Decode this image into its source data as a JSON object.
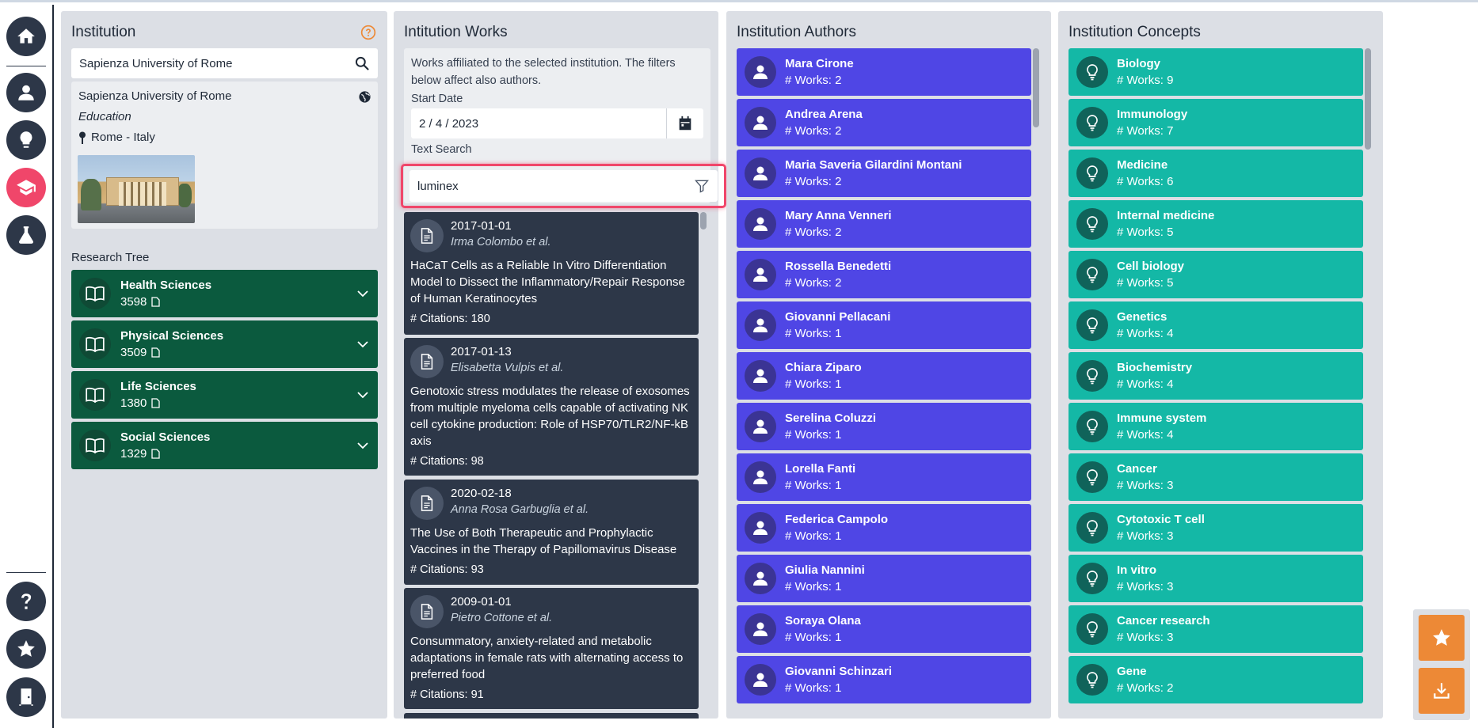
{
  "institution": {
    "panel_title": "Institution",
    "search_value": "Sapienza University of Rome",
    "name": "Sapienza University of Rome",
    "type": "Education",
    "location": "Rome - Italy",
    "research_tree_label": "Research Tree",
    "tree": [
      {
        "label": "Health Sciences",
        "count": "3598"
      },
      {
        "label": "Physical Sciences",
        "count": "3509"
      },
      {
        "label": "Life Sciences",
        "count": "1380"
      },
      {
        "label": "Social Sciences",
        "count": "1329"
      }
    ]
  },
  "works": {
    "panel_title": "Intitution Works",
    "description": "Works affiliated to the selected institution. The filters below affect also authors.",
    "start_date_label": "Start Date",
    "start_date_value": "2 / 4 / 2023",
    "text_search_label": "Text Search",
    "text_search_value": "luminex",
    "items": [
      {
        "date": "2017-01-01",
        "authors": "Irma Colombo et al.",
        "title": "HaCaT Cells as a Reliable In Vitro Differentiation Model to Dissect the Inflammatory/Repair Response of Human Keratinocytes",
        "citations": "# Citations: 180"
      },
      {
        "date": "2017-01-13",
        "authors": "Elisabetta Vulpis et al.",
        "title": "Genotoxic stress modulates the release of exosomes from multiple myeloma cells capable of activating NK cell cytokine production: Role of HSP70/TLR2/NF-kB axis",
        "citations": "# Citations: 98"
      },
      {
        "date": "2020-02-18",
        "authors": "Anna Rosa Garbuglia et al.",
        "title": "The Use of Both Therapeutic and Prophylactic Vaccines in the Therapy of Papillomavirus Disease",
        "citations": "# Citations: 93"
      },
      {
        "date": "2009-01-01",
        "authors": "Pietro Cottone et al.",
        "title": "Consummatory, anxiety-related and metabolic adaptations in female rats with alternating access to preferred food",
        "citations": "# Citations: 91"
      }
    ]
  },
  "authors": {
    "panel_title": "Institution Authors",
    "items": [
      {
        "name": "Mara Cirone",
        "works": "# Works: 2"
      },
      {
        "name": "Andrea Arena",
        "works": "# Works: 2"
      },
      {
        "name": "Maria Saveria Gilardini Montani",
        "works": "# Works: 2"
      },
      {
        "name": "Mary Anna Venneri",
        "works": "# Works: 2"
      },
      {
        "name": "Rossella Benedetti",
        "works": "# Works: 2"
      },
      {
        "name": "Giovanni Pellacani",
        "works": "# Works: 1"
      },
      {
        "name": "Chiara Ziparo",
        "works": "# Works: 1"
      },
      {
        "name": "Serelina Coluzzi",
        "works": "# Works: 1"
      },
      {
        "name": "Lorella Fanti",
        "works": "# Works: 1"
      },
      {
        "name": "Federica Campolo",
        "works": "# Works: 1"
      },
      {
        "name": "Giulia Nannini",
        "works": "# Works: 1"
      },
      {
        "name": "Soraya Olana",
        "works": "# Works: 1"
      },
      {
        "name": "Giovanni Schinzari",
        "works": "# Works: 1"
      }
    ]
  },
  "concepts": {
    "panel_title": "Institution Concepts",
    "items": [
      {
        "name": "Biology",
        "works": "# Works: 9"
      },
      {
        "name": "Immunology",
        "works": "# Works: 7"
      },
      {
        "name": "Medicine",
        "works": "# Works: 6"
      },
      {
        "name": "Internal medicine",
        "works": "# Works: 5"
      },
      {
        "name": "Cell biology",
        "works": "# Works: 5"
      },
      {
        "name": "Genetics",
        "works": "# Works: 4"
      },
      {
        "name": "Biochemistry",
        "works": "# Works: 4"
      },
      {
        "name": "Immune system",
        "works": "# Works: 4"
      },
      {
        "name": "Cancer",
        "works": "# Works: 3"
      },
      {
        "name": "Cytotoxic T cell",
        "works": "# Works: 3"
      },
      {
        "name": "In vitro",
        "works": "# Works: 3"
      },
      {
        "name": "Cancer research",
        "works": "# Works: 3"
      },
      {
        "name": "Gene",
        "works": "# Works: 2"
      }
    ]
  },
  "icons": {
    "nav": [
      "home-icon",
      "user-icon",
      "lightbulb-icon",
      "graduation-cap-icon",
      "flask-icon",
      "question-icon",
      "star-icon",
      "door-exit-icon"
    ]
  },
  "colors": {
    "accent_active": "#f0466a",
    "nav_dark": "#2d3748",
    "tree_green": "#0b5a3e",
    "author_indigo": "#4f46e5",
    "concept_teal": "#14b8a6",
    "highlight": "#f0466a",
    "fab_orange": "#ed8936"
  }
}
